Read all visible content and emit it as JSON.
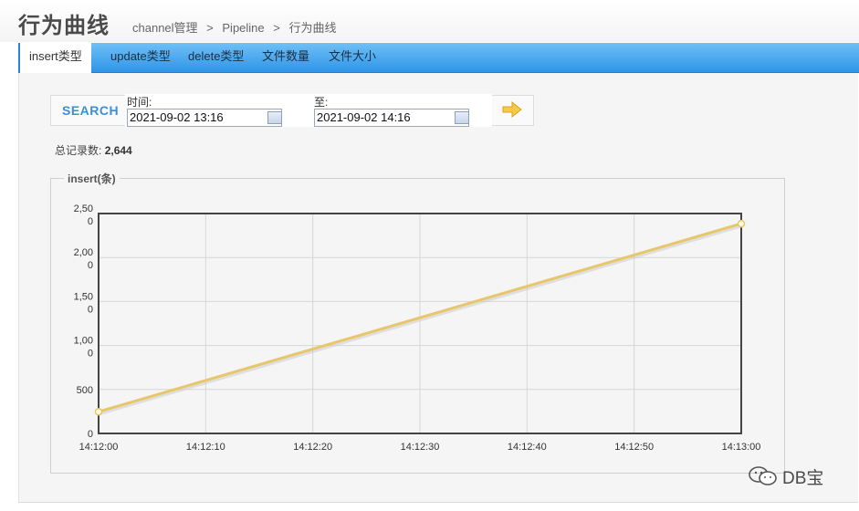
{
  "header": {
    "title": "行为曲线",
    "breadcrumb": [
      "channel管理",
      ">",
      "Pipeline",
      ">",
      "行为曲线"
    ]
  },
  "tabs": [
    {
      "label": "insert类型",
      "active": true
    },
    {
      "label": "update类型",
      "active": false
    },
    {
      "label": "delete类型",
      "active": false
    },
    {
      "label": "文件数量",
      "active": false
    },
    {
      "label": "文件大小",
      "active": false
    }
  ],
  "search": {
    "label": "SEARCH",
    "time_label": "时间:",
    "start_value": "2021-09-02 13:16",
    "to_label": "至:",
    "end_value": "2021-09-02 14:16"
  },
  "summary": {
    "label": "总记录数:",
    "value": "2,644"
  },
  "chart_panel": {
    "legend": "insert(条)"
  },
  "chart_data": {
    "type": "line",
    "title": "",
    "xlabel": "",
    "ylabel": "",
    "x": [
      "14:12:00",
      "14:12:10",
      "14:12:20",
      "14:12:30",
      "14:12:40",
      "14:12:50",
      "14:13:00"
    ],
    "series": [
      {
        "values": [
          247,
          null,
          null,
          null,
          null,
          null,
          2385
        ],
        "color": "#e8c66a"
      }
    ],
    "y_ticks": [
      {
        "value": 0,
        "label": [
          "0"
        ]
      },
      {
        "value": 500,
        "label": [
          "500"
        ]
      },
      {
        "value": 1000,
        "label": [
          "1,00",
          "0"
        ]
      },
      {
        "value": 1500,
        "label": [
          "1,50",
          "0"
        ]
      },
      {
        "value": 2000,
        "label": [
          "2,00",
          "0"
        ]
      },
      {
        "value": 2500,
        "label": [
          "2,50",
          "0"
        ]
      }
    ],
    "ylim": [
      0,
      2500
    ],
    "grid": true
  },
  "watermark": {
    "text": "DB宝"
  },
  "colors": {
    "tab_gradient_top": "#6fc0f5",
    "tab_gradient_bottom": "#2f95e8",
    "search_accent": "#3a8fd8",
    "line": "#e8c66a"
  },
  "icons": {
    "calendar": "calendar-icon",
    "go": "arrow-right-icon",
    "watermark": "wechat-icon"
  }
}
